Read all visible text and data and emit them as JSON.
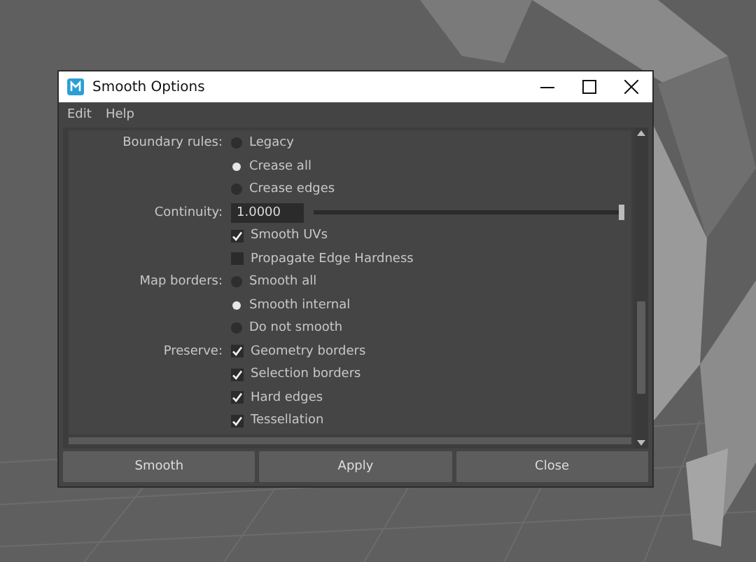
{
  "window": {
    "title": "Smooth Options"
  },
  "menu": [
    "Edit",
    "Help"
  ],
  "sections": [
    {
      "kind": "radio",
      "label": "Boundary rules:",
      "options": [
        {
          "label": "Legacy",
          "selected": false
        },
        {
          "label": "Crease all",
          "selected": true
        },
        {
          "label": "Crease edges",
          "selected": false
        }
      ]
    },
    {
      "kind": "slider",
      "label": "Continuity:",
      "value": "1.0000",
      "level": 1
    },
    {
      "kind": "checkbox",
      "options": [
        {
          "label": "Smooth UVs",
          "checked": true
        },
        {
          "label": "Propagate Edge Hardness",
          "checked": false
        }
      ]
    },
    {
      "kind": "radio",
      "label": "Map borders:",
      "options": [
        {
          "label": "Smooth all",
          "selected": false
        },
        {
          "label": "Smooth internal",
          "selected": true
        },
        {
          "label": "Do not smooth",
          "selected": false
        }
      ]
    },
    {
      "kind": "checkbox",
      "label": "Preserve:",
      "options": [
        {
          "label": "Geometry borders",
          "checked": true
        },
        {
          "label": "Selection borders",
          "checked": true
        },
        {
          "label": "Hard edges",
          "checked": true
        },
        {
          "label": "Tessellation",
          "checked": true
        }
      ]
    }
  ],
  "buttons": [
    "Smooth",
    "Apply",
    "Close"
  ]
}
